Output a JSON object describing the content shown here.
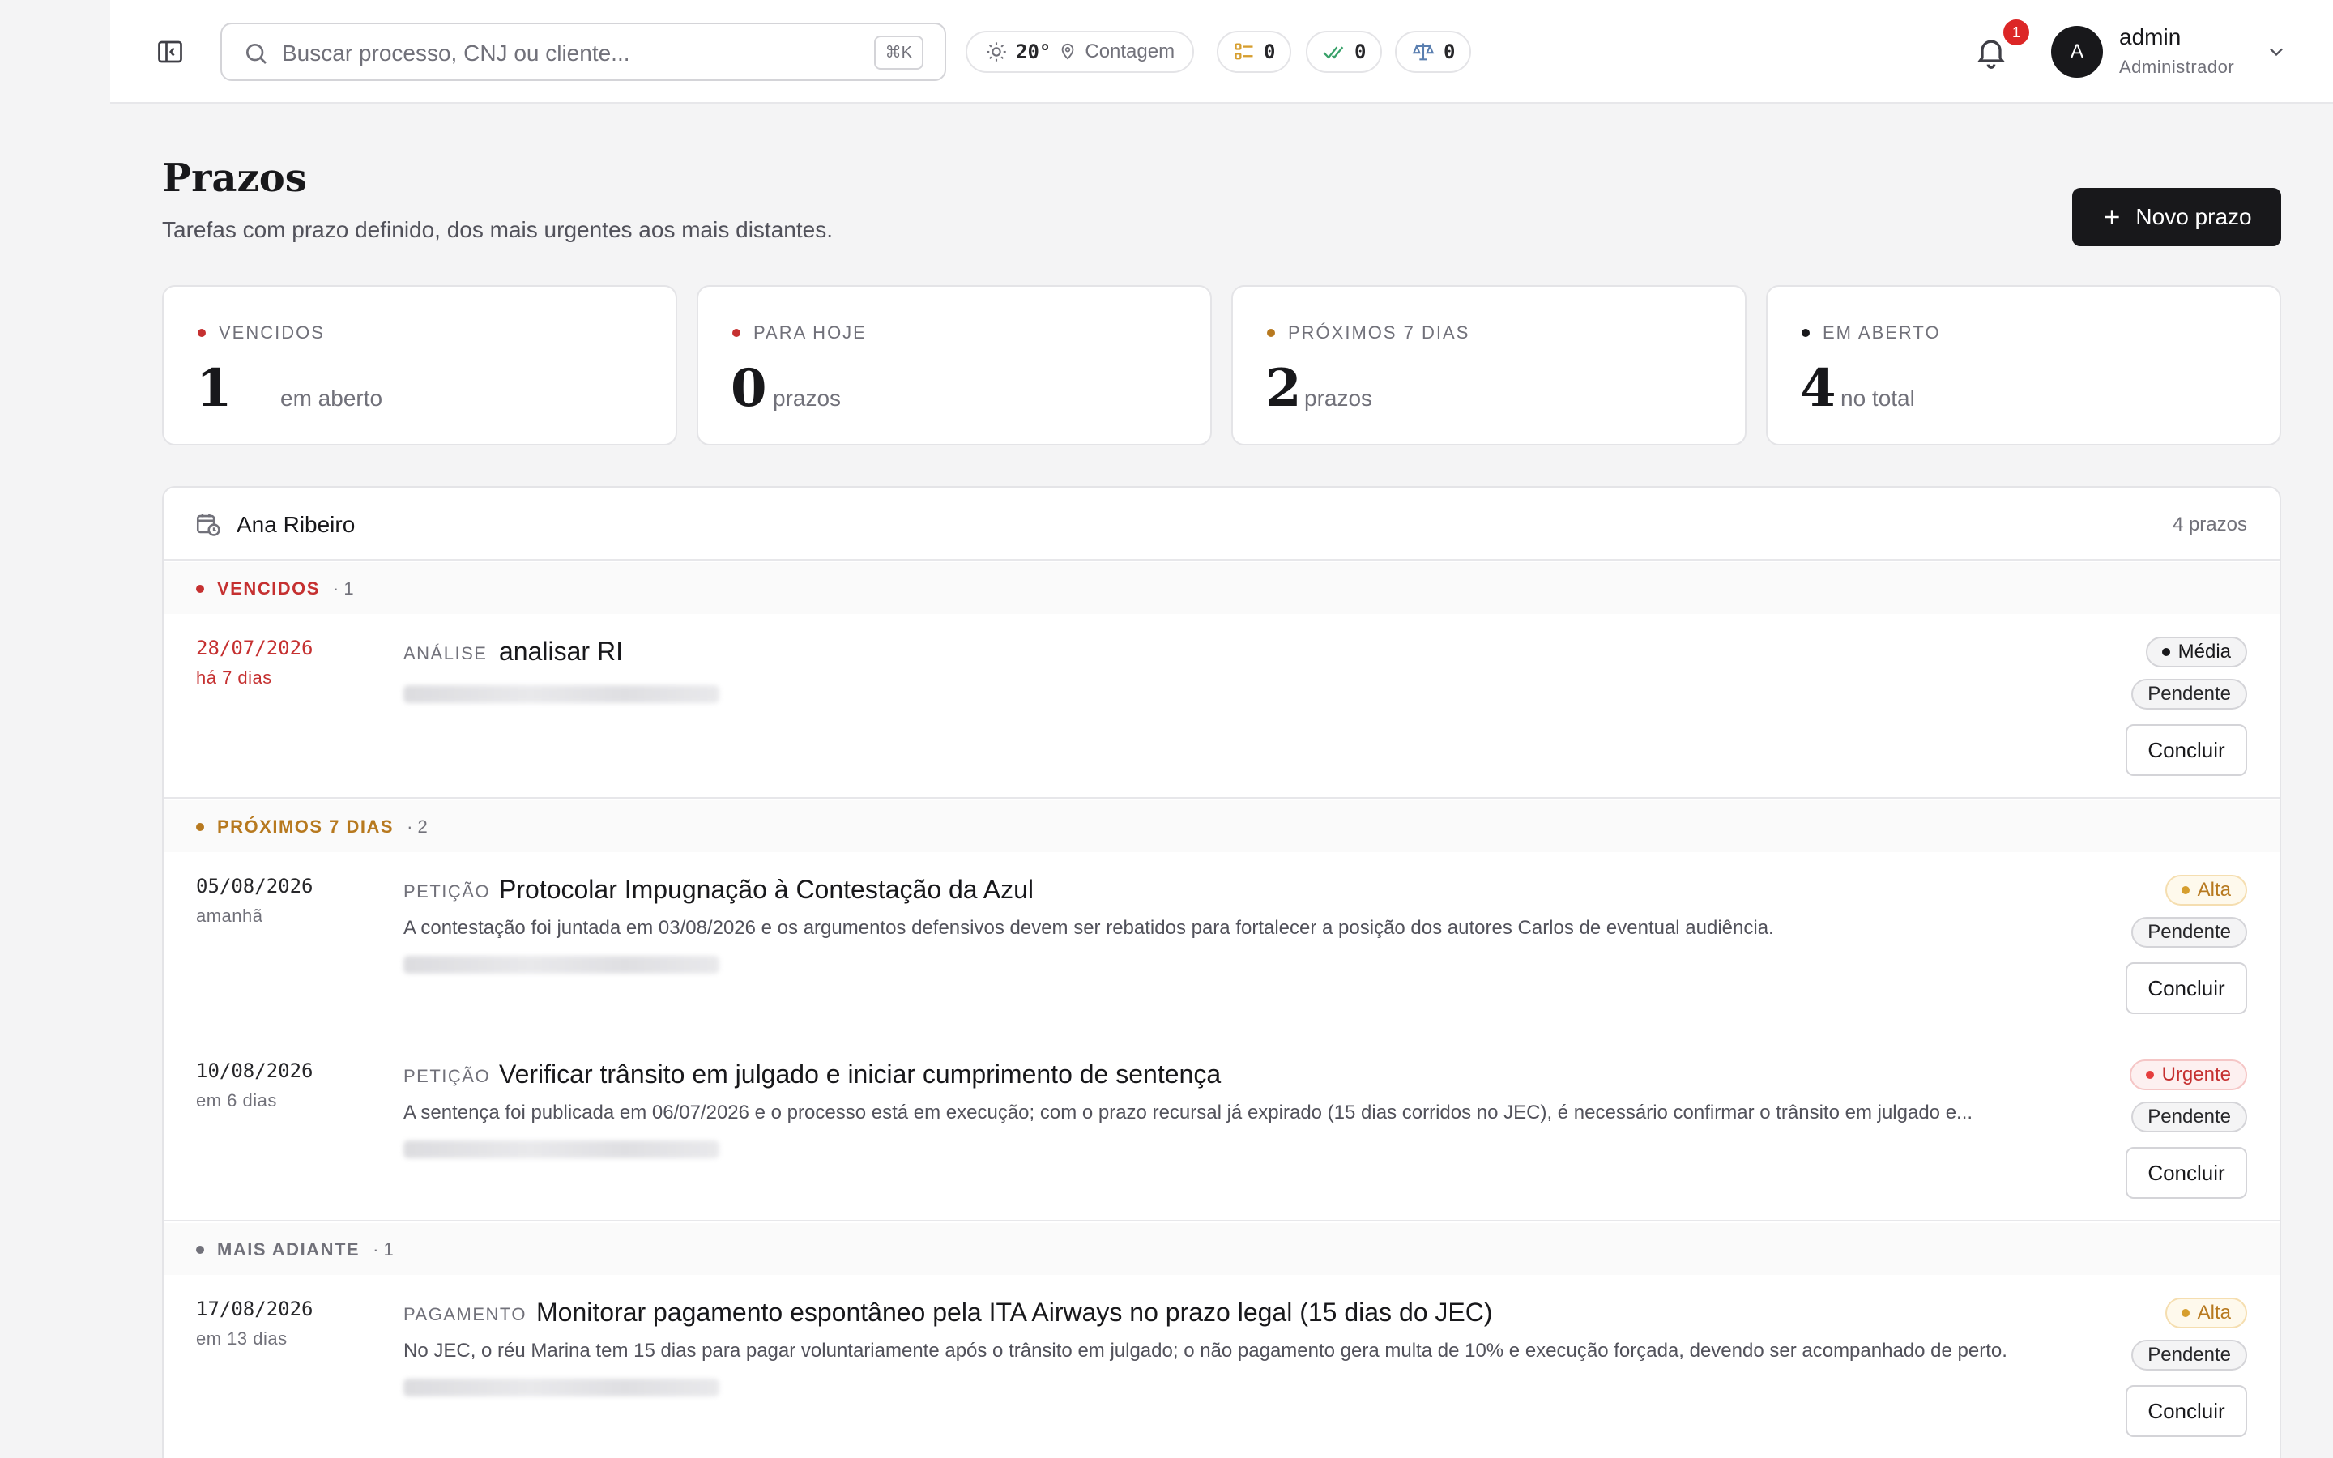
{
  "header": {
    "search_placeholder": "Buscar processo, CNJ ou cliente...",
    "search_shortcut": "⌘K",
    "weather_temp": "20°",
    "weather_city": "Contagem",
    "counter_tasks": "0",
    "counter_done": "0",
    "counter_cases": "0",
    "notifications": "1",
    "user_initial": "A",
    "user_name": "admin",
    "user_role": "Administrador"
  },
  "page": {
    "title": "Prazos",
    "subtitle": "Tarefas com prazo definido, dos mais urgentes aos mais distantes.",
    "new_button": "Novo prazo"
  },
  "stats": [
    {
      "label": "VENCIDOS",
      "value": "1",
      "unit": "em aberto",
      "color": "#c53030"
    },
    {
      "label": "PARA HOJE",
      "value": "0",
      "unit": "prazos",
      "color": "#c53030"
    },
    {
      "label": "PRÓXIMOS 7 DIAS",
      "value": "2",
      "unit": "prazos",
      "color": "#b7791f"
    },
    {
      "label": "EM ABERTO",
      "value": "4",
      "unit": "no total",
      "color": "#18181b"
    }
  ],
  "panel": {
    "owner": "Ana Ribeiro",
    "count": "4 prazos"
  },
  "groups": [
    {
      "label": "VENCIDOS",
      "count": "· 1",
      "color": "#c53030"
    },
    {
      "label": "PRÓXIMOS 7 DIAS",
      "count": "· 2",
      "color": "#b7791f"
    },
    {
      "label": "MAIS ADIANTE",
      "count": "· 1",
      "color": "#71717a"
    }
  ],
  "tasks": [
    {
      "date": "28/07/2026",
      "relative": "há 7 dias",
      "category": "ANÁLISE",
      "title": "analisar RI",
      "description": "",
      "priority": "Média",
      "status": "Pendente",
      "action": "Concluir"
    },
    {
      "date": "05/08/2026",
      "relative": "amanhã",
      "category": "PETIÇÃO",
      "title": "Protocolar Impugnação à Contestação da Azul",
      "description": "A contestação foi juntada em 03/08/2026 e os argumentos defensivos devem ser rebatidos para fortalecer a posição dos autores Carlos de eventual audiência.",
      "priority": "Alta",
      "status": "Pendente",
      "action": "Concluir"
    },
    {
      "date": "10/08/2026",
      "relative": "em 6 dias",
      "category": "PETIÇÃO",
      "title": "Verificar trânsito em julgado e iniciar cumprimento de sentença",
      "description": "A sentença foi publicada em 06/07/2026 e o processo está em execução; com o prazo recursal já expirado (15 dias corridos no JEC), é necessário confirmar o trânsito em julgado e...",
      "priority": "Urgente",
      "status": "Pendente",
      "action": "Concluir"
    },
    {
      "date": "17/08/2026",
      "relative": "em 13 dias",
      "category": "PAGAMENTO",
      "title": "Monitorar pagamento espontâneo pela ITA Airways no prazo legal (15 dias do JEC)",
      "description": "No JEC, o réu Marina tem 15 dias para pagar voluntariamente após o trânsito em julgado; o não pagamento gera multa de 10% e execução forçada, devendo ser acompanhado de perto.",
      "priority": "Alta",
      "status": "Pendente",
      "action": "Concluir"
    }
  ],
  "colors": {
    "overdue": "#c53030",
    "soon": "#b7791f",
    "later": "#71717a",
    "primary": "#18181b"
  }
}
